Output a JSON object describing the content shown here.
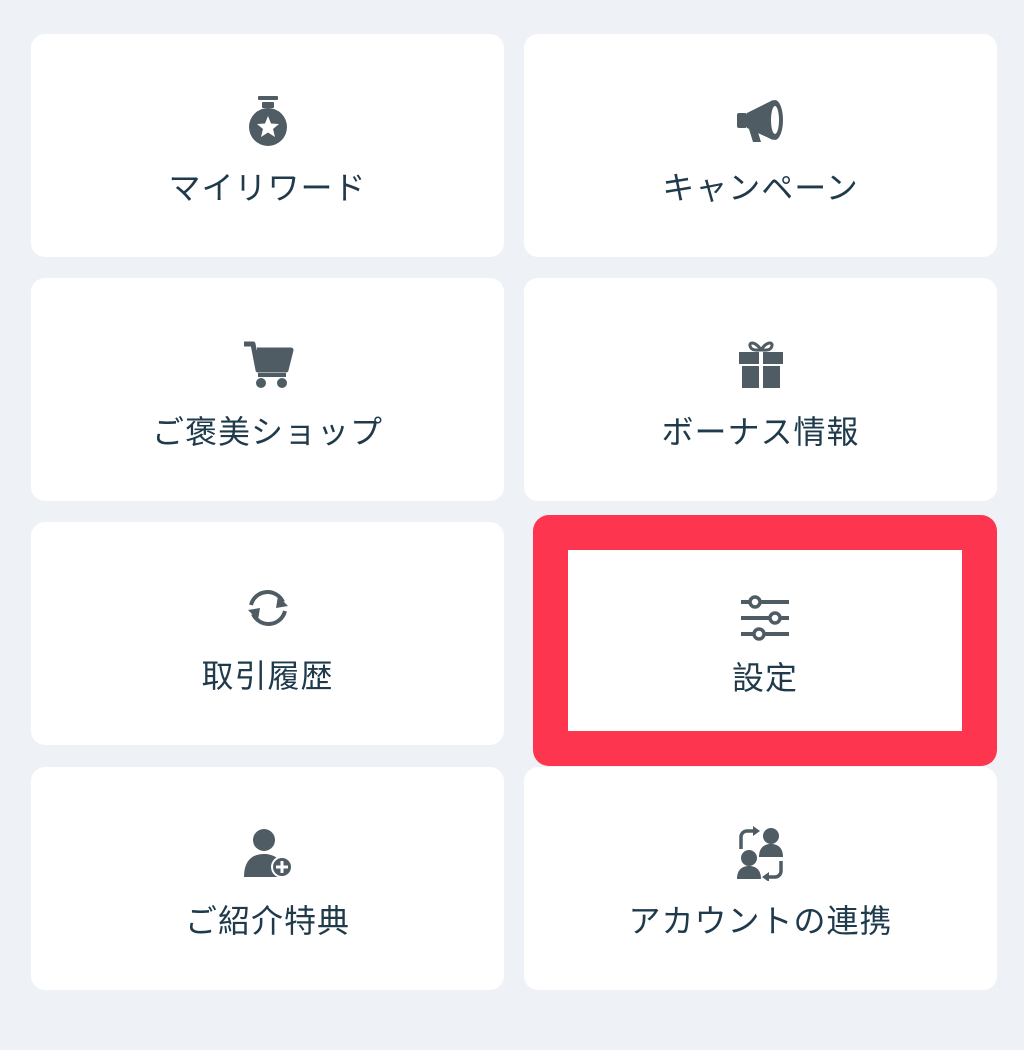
{
  "colors": {
    "background": "#eef1f6",
    "tile": "#ffffff",
    "icon": "#4f5c64",
    "text": "#1f3a4b",
    "highlight": "#fe354f"
  },
  "menu": {
    "items": [
      {
        "label": "マイリワード",
        "icon": "medal-star-icon"
      },
      {
        "label": "キャンペーン",
        "icon": "megaphone-icon"
      },
      {
        "label": "ご褒美ショップ",
        "icon": "cart-icon"
      },
      {
        "label": "ボーナス情報",
        "icon": "gift-icon"
      },
      {
        "label": "取引履歴",
        "icon": "sync-icon"
      },
      {
        "label": "設定",
        "icon": "sliders-icon",
        "highlighted": true
      },
      {
        "label": "ご紹介特典",
        "icon": "user-add-icon"
      },
      {
        "label": "アカウントの連携",
        "icon": "account-link-icon"
      }
    ]
  }
}
